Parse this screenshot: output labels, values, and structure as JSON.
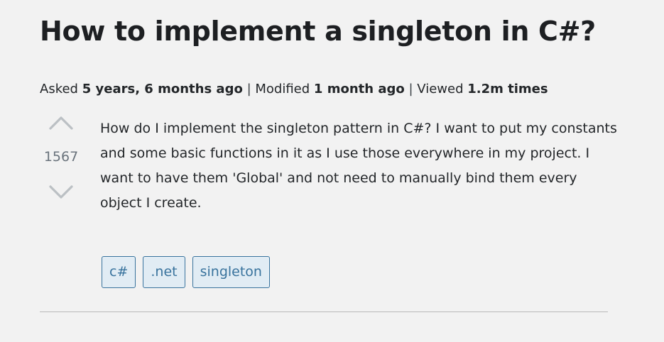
{
  "question": {
    "title": "How to implement a singleton in C#?",
    "meta": {
      "asked_label": "Asked",
      "asked_value": "5 years, 6 months ago",
      "modified_label": "Modified",
      "modified_value": "1 month ago",
      "viewed_label": "Viewed",
      "viewed_value": "1.2m times",
      "separator": "|"
    },
    "votes": {
      "count": "1567",
      "up_icon": "chevron-up-icon",
      "down_icon": "chevron-down-icon"
    },
    "body": "How do I implement the singleton pattern in C#? I want to put my constants and some basic functions in it as I use those everywhere in my project. I want to have them 'Global' and not need to manually bind them every object I create.",
    "tags": [
      "c#",
      ".net",
      "singleton"
    ]
  },
  "colors": {
    "background": "#f2f2f2",
    "tag_text": "#39739d",
    "tag_background": "#e1ecf4",
    "vote_icon": "#bbc0c4",
    "vote_count": "#6a737c"
  }
}
